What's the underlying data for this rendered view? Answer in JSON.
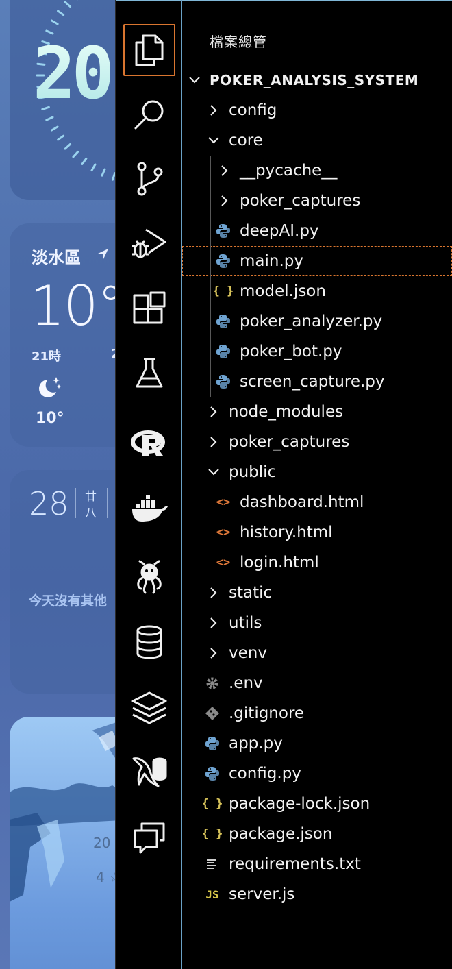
{
  "desktop": {
    "clock_text": "20",
    "weather": {
      "city": "淡水區",
      "temperature": "10°",
      "hour": "21時",
      "hour_next": "2",
      "low": "10°"
    },
    "calendar": {
      "day": "28",
      "lunar_top": "廿",
      "lunar_bottom": "八",
      "note": "今天沒有其他"
    },
    "photo": {
      "text_top": "20",
      "text_bottom": "4 ☆"
    }
  },
  "activity_bar": {
    "items": [
      {
        "name": "explorer-icon",
        "active": true
      },
      {
        "name": "search-icon",
        "active": false
      },
      {
        "name": "source-control-icon",
        "active": false
      },
      {
        "name": "run-debug-icon",
        "active": false
      },
      {
        "name": "extensions-icon",
        "active": false
      },
      {
        "name": "testing-flask-icon",
        "active": false
      },
      {
        "name": "r-language-icon",
        "active": false
      },
      {
        "name": "docker-icon",
        "active": false
      },
      {
        "name": "octopus-icon",
        "active": false
      },
      {
        "name": "database-icon",
        "active": false
      },
      {
        "name": "layers-icon",
        "active": false
      },
      {
        "name": "mysql-icon",
        "active": false
      },
      {
        "name": "chat-icon",
        "active": false
      }
    ],
    "accent_color": "#d9752f"
  },
  "explorer": {
    "title": "檔案總管",
    "root": "POKER_ANALYSIS_SYSTEM",
    "tree": [
      {
        "label": "config",
        "kind": "folder",
        "open": false,
        "depth": 1
      },
      {
        "label": "core",
        "kind": "folder",
        "open": true,
        "depth": 1
      },
      {
        "label": "__pycache__",
        "kind": "folder",
        "open": false,
        "depth": 2
      },
      {
        "label": "poker_captures",
        "kind": "folder",
        "open": false,
        "depth": 2
      },
      {
        "label": "deepAI.py",
        "kind": "python",
        "depth": 2
      },
      {
        "label": "main.py",
        "kind": "python",
        "depth": 2,
        "selected": true
      },
      {
        "label": "model.json",
        "kind": "json",
        "depth": 2
      },
      {
        "label": "poker_analyzer.py",
        "kind": "python",
        "depth": 2
      },
      {
        "label": "poker_bot.py",
        "kind": "python",
        "depth": 2
      },
      {
        "label": "screen_capture.py",
        "kind": "python",
        "depth": 2
      },
      {
        "label": "node_modules",
        "kind": "folder",
        "open": false,
        "depth": 1
      },
      {
        "label": "poker_captures",
        "kind": "folder",
        "open": false,
        "depth": 1
      },
      {
        "label": "public",
        "kind": "folder",
        "open": true,
        "depth": 1
      },
      {
        "label": "dashboard.html",
        "kind": "html",
        "depth": 2
      },
      {
        "label": "history.html",
        "kind": "html",
        "depth": 2
      },
      {
        "label": "login.html",
        "kind": "html",
        "depth": 2
      },
      {
        "label": "static",
        "kind": "folder",
        "open": false,
        "depth": 1
      },
      {
        "label": "utils",
        "kind": "folder",
        "open": false,
        "depth": 1
      },
      {
        "label": "venv",
        "kind": "folder",
        "open": false,
        "depth": 1
      },
      {
        "label": ".env",
        "kind": "env",
        "depth": 1
      },
      {
        "label": ".gitignore",
        "kind": "git",
        "depth": 1
      },
      {
        "label": "app.py",
        "kind": "python",
        "depth": 1
      },
      {
        "label": "config.py",
        "kind": "python",
        "depth": 1
      },
      {
        "label": "package-lock.json",
        "kind": "json",
        "depth": 1
      },
      {
        "label": "package.json",
        "kind": "json",
        "depth": 1
      },
      {
        "label": "requirements.txt",
        "kind": "text",
        "depth": 1
      },
      {
        "label": "server.js",
        "kind": "js",
        "depth": 1
      }
    ],
    "colors": {
      "python": "#6fa4d2",
      "json": "#d6c25a",
      "html": "#e0793a",
      "env": "#8a8a8a",
      "git": "#8a8a8a",
      "js": "#d8c74a"
    }
  }
}
